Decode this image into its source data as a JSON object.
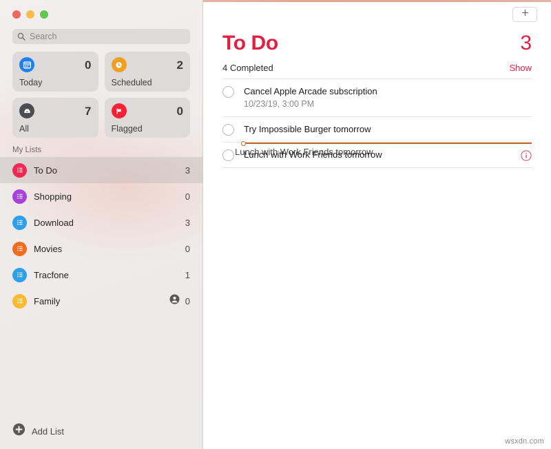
{
  "window": {
    "traffic_lights": [
      {
        "name": "close",
        "color": "#ec6a5f"
      },
      {
        "name": "minimize",
        "color": "#f4bd4f"
      },
      {
        "name": "zoom",
        "color": "#61c554"
      }
    ]
  },
  "sidebar": {
    "search": {
      "placeholder": "Search",
      "value": ""
    },
    "smart_lists": [
      {
        "label": "Today",
        "count": "0",
        "icon": "calendar-icon",
        "color": "#2080f0"
      },
      {
        "label": "Scheduled",
        "count": "2",
        "icon": "clock-icon",
        "color": "#f0a020"
      },
      {
        "label": "All",
        "count": "7",
        "icon": "tray-icon",
        "color": "#4d4c52"
      },
      {
        "label": "Flagged",
        "count": "0",
        "icon": "flag-icon",
        "color": "#f42033"
      }
    ],
    "section_header": "My Lists",
    "lists": [
      {
        "label": "To Do",
        "count": "3",
        "color": "#ed2a56",
        "selected": true,
        "shared": false
      },
      {
        "label": "Shopping",
        "count": "0",
        "color": "#a843d8",
        "selected": false,
        "shared": false
      },
      {
        "label": "Download",
        "count": "3",
        "color": "#2e9fe8",
        "selected": false,
        "shared": false
      },
      {
        "label": "Movies",
        "count": "0",
        "color": "#f36a21",
        "selected": false,
        "shared": false
      },
      {
        "label": "Tracfone",
        "count": "1",
        "color": "#2e9fe8",
        "selected": false,
        "shared": false
      },
      {
        "label": "Family",
        "count": "0",
        "color": "#f7bb33",
        "selected": false,
        "shared": true
      }
    ],
    "add_list_label": "Add List"
  },
  "content": {
    "add_button_icon": "plus-icon",
    "title": "To Do",
    "count": "3",
    "accent_color": "#e02144",
    "completed_text": "4 Completed",
    "show_link": "Show",
    "reminders": [
      {
        "title": "Cancel Apple Arcade subscription",
        "date": "10/23/19, 3:00 PM",
        "has_info": false
      },
      {
        "title": "Try Impossible Burger tomorrow",
        "date": "",
        "has_info": false
      },
      {
        "title": "Lunch with Work Friends tomorrow",
        "date": "",
        "has_info": true
      }
    ],
    "drag": {
      "ghost_text": "Lunch with Work Friends tomorrow",
      "indicator_color": "#c0672f"
    }
  },
  "watermark": "wsxdn.com"
}
